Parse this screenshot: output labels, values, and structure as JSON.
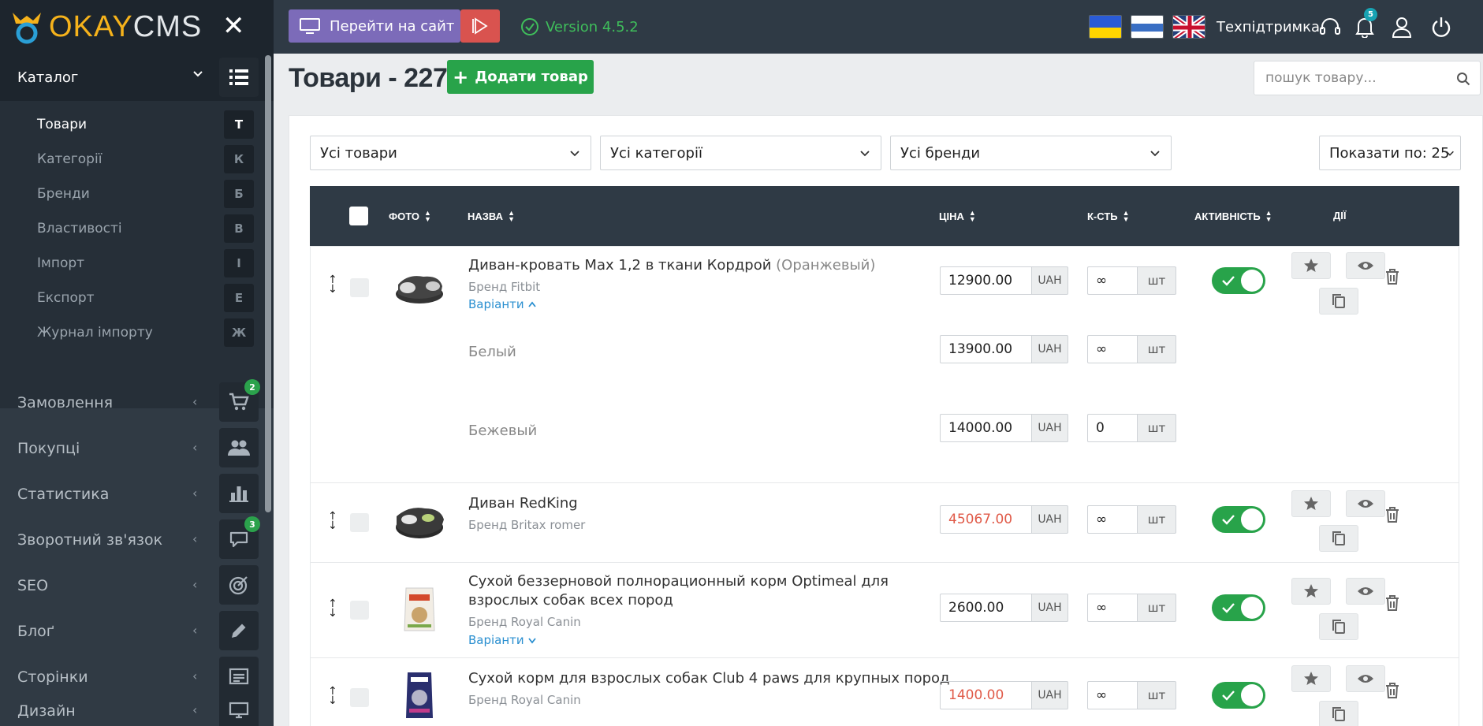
{
  "app": {
    "logo_okay": "OKAY",
    "logo_cms": "CMS"
  },
  "sidebar": {
    "catalog_label": "Каталог",
    "sub_items": [
      {
        "label": "Товари",
        "letter": "Т",
        "active": true
      },
      {
        "label": "Категорії",
        "letter": "К"
      },
      {
        "label": "Бренди",
        "letter": "Б"
      },
      {
        "label": "Властивості",
        "letter": "В"
      },
      {
        "label": "Імпорт",
        "letter": "І"
      },
      {
        "label": "Експорт",
        "letter": "Е"
      },
      {
        "label": "Журнал імпорту",
        "letter": "Ж"
      }
    ],
    "menu": [
      {
        "label": "Замовлення",
        "icon": "cart-icon",
        "badge": "2"
      },
      {
        "label": "Покупці",
        "icon": "users-icon"
      },
      {
        "label": "Статистика",
        "icon": "bar-chart-icon"
      },
      {
        "label": "Зворотний зв'язок",
        "icon": "chat-icon",
        "badge": "3"
      },
      {
        "label": "SEO",
        "icon": "target-icon"
      },
      {
        "label": "Блоґ",
        "icon": "pencil-icon"
      },
      {
        "label": "Сторінки",
        "icon": "page-icon"
      },
      {
        "label": "Дизайн",
        "icon": "monitor-brush-icon"
      }
    ]
  },
  "topbar": {
    "site_button": "Перейти на сайт",
    "version": "Version 4.5.2",
    "support": "Техпідтримка",
    "notifications_count": "5"
  },
  "main": {
    "title": "Товари - 227",
    "add_button": "Додати товар",
    "search_placeholder": "пошук товару...",
    "filters": {
      "products": "Усі товари",
      "categories": "Усі категорії",
      "brands": "Усі бренди",
      "per_page": "Показати по: 25"
    },
    "columns": {
      "photo": "ФОТО",
      "name": "НАЗВА",
      "price": "ЦІНА",
      "qty": "К-СТЬ",
      "active": "АКТИВНІСТЬ",
      "actions": "ДІЇ"
    },
    "currency": "UAH",
    "unit": "шт",
    "products": [
      {
        "name": "Диван-кровать Max 1,2 в ткани Кордрой",
        "variant": "(Оранжевый)",
        "brand": "Бренд Fitbit",
        "variants_label": "Варіанти",
        "price": "12900.00",
        "qty": "∞",
        "extra_variants": [
          {
            "name": "Белый",
            "price": "13900.00",
            "qty": "∞"
          },
          {
            "name": "Бежевый",
            "price": "14000.00",
            "qty": "0"
          }
        ]
      },
      {
        "name": "Диван RedKing",
        "brand": "Бренд Britax romer",
        "price": "45067.00",
        "qty": "∞"
      },
      {
        "name_line1": "Сухой беззерновой полнорационный корм Optimeal для",
        "name_line2": "взрослых собак всех пород",
        "brand": "Бренд Royal Canin",
        "variants_label": "Варіанти",
        "price": "2600.00",
        "qty": "∞"
      },
      {
        "name": "Сухой корм для взрослых собак Club 4 paws для крупных пород",
        "brand": "Бренд Royal Canin",
        "price": "1400.00",
        "qty": "∞"
      }
    ]
  },
  "colors": {
    "accent_green": "#28a34a",
    "sidebar_bg": "#303a44",
    "price_red": "#e05a48",
    "brand_purple": "#7c6bb9"
  }
}
